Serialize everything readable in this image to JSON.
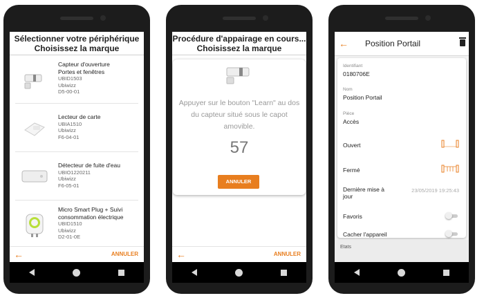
{
  "accent": "#e87e1f",
  "screen1": {
    "title_line1": "Sélectionner votre périphérique",
    "title_line2": "Choisissez la marque",
    "devices": [
      {
        "name": "Capteur d'ouverture Portes et fenêtres",
        "code": "UBID1503",
        "brand": "Ubiwizz",
        "eep": "D5-00-01"
      },
      {
        "name": "Lecteur de carte",
        "code": "UBIA1510",
        "brand": "Ubiwizz",
        "eep": "F6-04-01"
      },
      {
        "name": "Détecteur de fuite d'eau",
        "code": "UBIO1220211",
        "brand": "Ubiwizz",
        "eep": "F6-05-01"
      },
      {
        "name": "Micro Smart Plug + Suivi consommation électrique",
        "code": "UBID1510",
        "brand": "Ubiwizz",
        "eep": "D2-01-0E"
      }
    ],
    "back_icon": "←",
    "cancel_label": "ANNULER"
  },
  "screen2": {
    "title_line1": "Procédure d'appairage en cours...",
    "title_line2": "Choisissez la marque",
    "instruction": "Appuyer sur le bouton \"Learn\" au dos du capteur situé sous le capot amovible.",
    "countdown": "57",
    "card_button": "ANNULER",
    "back_icon": "←",
    "cancel_label": "ANNULER"
  },
  "screen3": {
    "title": "Position Portail",
    "back_icon": "←",
    "identifiant_label": "Identifiant",
    "identifiant_value": "0180706E",
    "nom_label": "Nom",
    "nom_value": "Position Portail",
    "piece_label": "Pièce",
    "piece_value": "Accès",
    "ouvert_label": "Ouvert",
    "ferme_label": "Fermé",
    "maj_label": "Dernière mise à jour",
    "maj_value": "23/05/2019 19:25:43",
    "favoris_label": "Favoris",
    "favoris_on": false,
    "cacher_label": "Cacher l'appareil",
    "cacher_on": false,
    "etats_label": "Etats"
  }
}
